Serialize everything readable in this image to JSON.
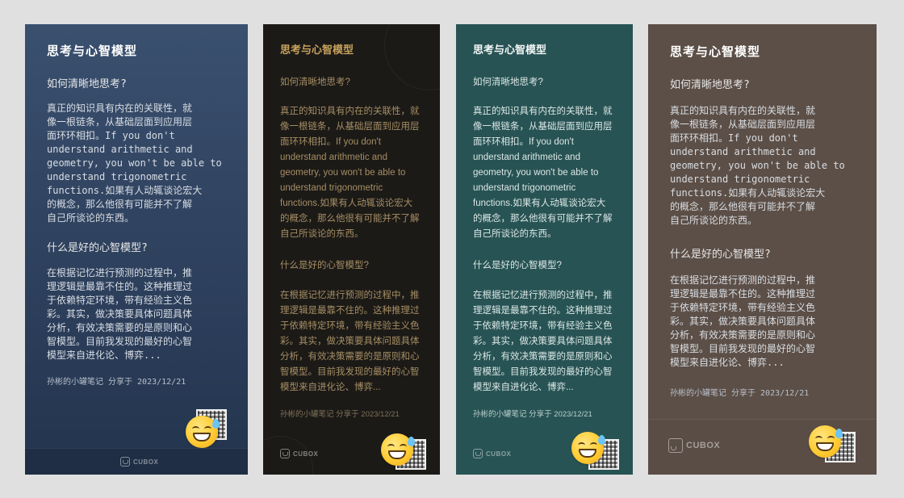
{
  "title": "思考与心智模型",
  "question1": "如何清晰地思考?",
  "paragraph1_mono": "真正的知识具有内在的关联性，就\n像一根链条，从基础层面到应用层\n面环环相扣。If you don't\nunderstand arithmetic and\ngeometry, you won't be able to\nunderstand trigonometric\nfunctions.如果有人动辄谈论宏大\n的概念，那么他很有可能并不了解\n自己所谈论的东西。",
  "paragraph1_sans": "真正的知识具有内在的关联性，就\n像一根链条，从基础层面到应用层\n面环环相扣。If you don't\nunderstand arithmetic and\ngeometry, you won't be able to\nunderstand trigonometric\nfunctions.如果有人动辄谈论宏大\n的概念，那么他很有可能并不了解\n自己所谈论的东西。",
  "question2": "什么是好的心智模型?",
  "paragraph2_mono": "在根据记忆进行预测的过程中，推\n理逻辑是最靠不住的。这种推理过\n于依赖特定环境，带有经验主义色\n彩。其实，做决策要具体问题具体\n分析，有效决策需要的是原则和心\n智模型。目前我发现的最好的心智\n模型来自进化论、博弈...",
  "paragraph2_sans": "在根据记忆进行预测的过程中，推\n理逻辑是最靠不住的。这种推理过\n于依赖特定环境，带有经验主义色\n彩。其实，做决策要具体问题具体\n分析，有效决策需要的是原则和心\n智模型。目前我发现的最好的心智\n模型来自进化论、博弈...",
  "footer": "孙彬的小罐笔记 分享于 2023/12/21",
  "brand": "CUBOX",
  "colors": {
    "card1_bg": "#2f4463",
    "card2_bg": "#1c1a17",
    "card3_bg": "#285354",
    "card4_bg": "#5c4f47"
  },
  "icons": {
    "emoji": "grinning-sweat-emoji-icon",
    "qr": "qr-code-icon",
    "logo": "cubox-logo-icon"
  }
}
